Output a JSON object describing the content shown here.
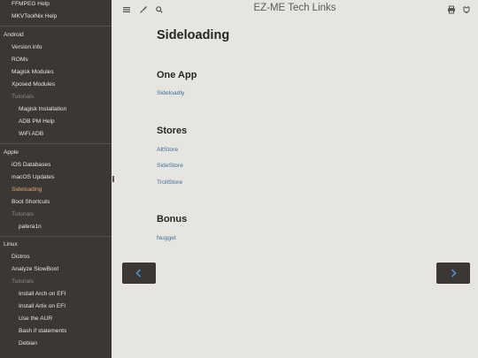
{
  "sidebar": {
    "items": [
      {
        "label": "FFMPEG Help"
      },
      {
        "label": "MKVToolNix Help"
      },
      {
        "label": "Android"
      },
      {
        "label": "Version info"
      },
      {
        "label": "ROMs"
      },
      {
        "label": "Magisk Modules"
      },
      {
        "label": "Xposed Modules"
      },
      {
        "label": "Tutorials"
      },
      {
        "label": "Magisk Installation"
      },
      {
        "label": "ADB PM Help"
      },
      {
        "label": "WiFi ADB"
      },
      {
        "label": "Apple"
      },
      {
        "label": "iOS Databases"
      },
      {
        "label": "macOS Updates"
      },
      {
        "label": "Sideloading"
      },
      {
        "label": "Boot Shortcuts"
      },
      {
        "label": "Tutorials"
      },
      {
        "label": "palera1n"
      },
      {
        "label": "Linux"
      },
      {
        "label": "Distros"
      },
      {
        "label": "Analyze SlowBoot"
      },
      {
        "label": "Tutorials"
      },
      {
        "label": "Install Arch on EFI"
      },
      {
        "label": "Install Artix on EFI"
      },
      {
        "label": "Use the AUR"
      },
      {
        "label": "Bash if statements"
      },
      {
        "label": "Debian"
      }
    ]
  },
  "header": {
    "title": "EZ-ME Tech Links",
    "icons": [
      "menu-icon",
      "brush-icon",
      "search-icon",
      "print-icon",
      "github-icon"
    ]
  },
  "main": {
    "page_title": "Sideloading",
    "sections": [
      {
        "heading": "One App",
        "links": [
          "Sideloadly"
        ]
      },
      {
        "heading": "Stores",
        "links": [
          "AltStore",
          "SideStore",
          "TrollStore"
        ]
      },
      {
        "heading": "Bonus",
        "links": [
          "Nugget"
        ]
      }
    ]
  },
  "colors": {
    "sidebar_bg": "#3b3735",
    "content_bg": "#e6e5e0",
    "active": "#e8a56a",
    "link": "#3a6f9a",
    "nav_arrow": "#4f8fc2"
  }
}
